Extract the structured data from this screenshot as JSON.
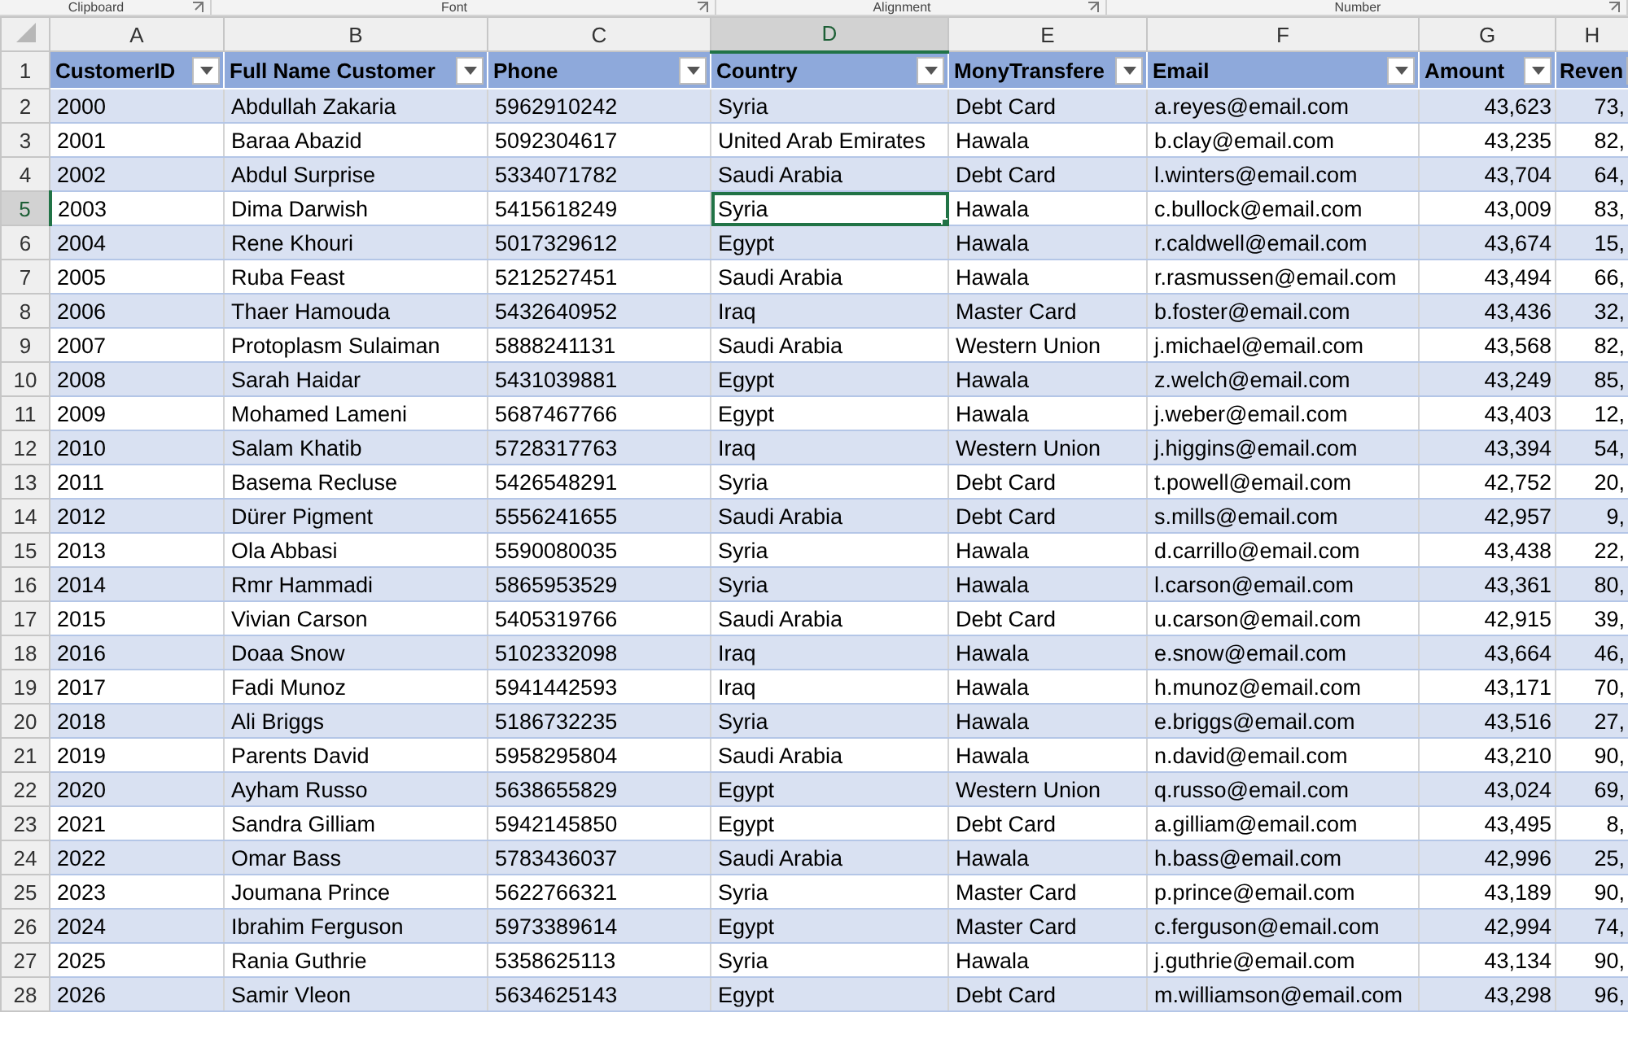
{
  "ribbon_groups": [
    "Clipboard",
    "Font",
    "Alignment",
    "Number"
  ],
  "columns": [
    {
      "letter": "A",
      "header": "CustomerID",
      "selected": false,
      "kind": "text"
    },
    {
      "letter": "B",
      "header": "Full Name Customer",
      "selected": false,
      "kind": "text"
    },
    {
      "letter": "C",
      "header": "Phone",
      "selected": false,
      "kind": "text"
    },
    {
      "letter": "D",
      "header": "Country",
      "selected": true,
      "kind": "text"
    },
    {
      "letter": "E",
      "header": "MonyTransfere",
      "selected": false,
      "kind": "text"
    },
    {
      "letter": "F",
      "header": "Email",
      "selected": false,
      "kind": "text"
    },
    {
      "letter": "G",
      "header": "Amount",
      "selected": false,
      "kind": "number"
    },
    {
      "letter": "H",
      "header": "Reven",
      "selected": false,
      "kind": "number"
    }
  ],
  "header_row_number": "1",
  "rows": [
    {
      "number": "2",
      "selected": false,
      "cells": [
        "2000",
        "Abdullah Zakaria",
        "5962910242",
        "Syria",
        "Debt Card",
        "a.reyes@email.com",
        "43,623",
        "73,"
      ]
    },
    {
      "number": "3",
      "selected": false,
      "cells": [
        "2001",
        "Baraa Abazid",
        "5092304617",
        "United Arab Emirates",
        "Hawala",
        "b.clay@email.com",
        "43,235",
        "82,"
      ]
    },
    {
      "number": "4",
      "selected": false,
      "cells": [
        "2002",
        "Abdul Surprise",
        "5334071782",
        "Saudi Arabia",
        "Debt Card",
        "l.winters@email.com",
        "43,704",
        "64,"
      ]
    },
    {
      "number": "5",
      "selected": true,
      "cells": [
        "2003",
        "Dima Darwish",
        "5415618249",
        "Syria",
        "Hawala",
        "c.bullock@email.com",
        "43,009",
        "83,"
      ]
    },
    {
      "number": "6",
      "selected": false,
      "cells": [
        "2004",
        "Rene Khouri",
        "5017329612",
        "Egypt",
        "Hawala",
        "r.caldwell@email.com",
        "43,674",
        "15,"
      ]
    },
    {
      "number": "7",
      "selected": false,
      "cells": [
        "2005",
        "Ruba Feast",
        "5212527451",
        "Saudi Arabia",
        "Hawala",
        "r.rasmussen@email.com",
        "43,494",
        "66,"
      ]
    },
    {
      "number": "8",
      "selected": false,
      "cells": [
        "2006",
        "Thaer Hamouda",
        "5432640952",
        "Iraq",
        "Master Card",
        "b.foster@email.com",
        "43,436",
        "32,"
      ]
    },
    {
      "number": "9",
      "selected": false,
      "cells": [
        "2007",
        "Protoplasm Sulaiman",
        "5888241131",
        "Saudi Arabia",
        "Western Union",
        "j.michael@email.com",
        "43,568",
        "82,"
      ]
    },
    {
      "number": "10",
      "selected": false,
      "cells": [
        "2008",
        "Sarah Haidar",
        "5431039881",
        "Egypt",
        "Hawala",
        "z.welch@email.com",
        "43,249",
        "85,"
      ]
    },
    {
      "number": "11",
      "selected": false,
      "cells": [
        "2009",
        "Mohamed Lameni",
        "5687467766",
        "Egypt",
        "Hawala",
        "j.weber@email.com",
        "43,403",
        "12,"
      ]
    },
    {
      "number": "12",
      "selected": false,
      "cells": [
        "2010",
        "Salam Khatib",
        "5728317763",
        "Iraq",
        "Western Union",
        "j.higgins@email.com",
        "43,394",
        "54,"
      ]
    },
    {
      "number": "13",
      "selected": false,
      "cells": [
        "2011",
        "Basema Recluse",
        "5426548291",
        "Syria",
        "Debt Card",
        "t.powell@email.com",
        "42,752",
        "20,"
      ]
    },
    {
      "number": "14",
      "selected": false,
      "cells": [
        "2012",
        "Dürer Pigment",
        "5556241655",
        "Saudi Arabia",
        "Debt Card",
        "s.mills@email.com",
        "42,957",
        "9,"
      ]
    },
    {
      "number": "15",
      "selected": false,
      "cells": [
        "2013",
        "Ola Abbasi",
        "5590080035",
        "Syria",
        "Hawala",
        "d.carrillo@email.com",
        "43,438",
        "22,"
      ]
    },
    {
      "number": "16",
      "selected": false,
      "cells": [
        "2014",
        "Rmr Hammadi",
        "5865953529",
        "Syria",
        "Hawala",
        "l.carson@email.com",
        "43,361",
        "80,"
      ]
    },
    {
      "number": "17",
      "selected": false,
      "cells": [
        "2015",
        "Vivian Carson",
        "5405319766",
        "Saudi Arabia",
        "Debt Card",
        "u.carson@email.com",
        "42,915",
        "39,"
      ]
    },
    {
      "number": "18",
      "selected": false,
      "cells": [
        "2016",
        "Doaa Snow",
        "5102332098",
        "Iraq",
        "Hawala",
        "e.snow@email.com",
        "43,664",
        "46,"
      ]
    },
    {
      "number": "19",
      "selected": false,
      "cells": [
        "2017",
        "Fadi Munoz",
        "5941442593",
        "Iraq",
        "Hawala",
        "h.munoz@email.com",
        "43,171",
        "70,"
      ]
    },
    {
      "number": "20",
      "selected": false,
      "cells": [
        "2018",
        "Ali Briggs",
        "5186732235",
        "Syria",
        "Hawala",
        "e.briggs@email.com",
        "43,516",
        "27,"
      ]
    },
    {
      "number": "21",
      "selected": false,
      "cells": [
        "2019",
        "Parents David",
        "5958295804",
        "Saudi Arabia",
        "Hawala",
        "n.david@email.com",
        "43,210",
        "90,"
      ]
    },
    {
      "number": "22",
      "selected": false,
      "cells": [
        "2020",
        "Ayham Russo",
        "5638655829",
        "Egypt",
        "Western Union",
        "q.russo@email.com",
        "43,024",
        "69,"
      ]
    },
    {
      "number": "23",
      "selected": false,
      "cells": [
        "2021",
        "Sandra Gilliam",
        "5942145850",
        "Egypt",
        "Debt Card",
        "a.gilliam@email.com",
        "43,495",
        "8,"
      ]
    },
    {
      "number": "24",
      "selected": false,
      "cells": [
        "2022",
        "Omar Bass",
        "5783436037",
        "Saudi Arabia",
        "Hawala",
        "h.bass@email.com",
        "42,996",
        "25,"
      ]
    },
    {
      "number": "25",
      "selected": false,
      "cells": [
        "2023",
        "Joumana Prince",
        "5622766321",
        "Syria",
        "Master Card",
        "p.prince@email.com",
        "43,189",
        "90,"
      ]
    },
    {
      "number": "26",
      "selected": false,
      "cells": [
        "2024",
        "Ibrahim Ferguson",
        "5973389614",
        "Egypt",
        "Master Card",
        "c.ferguson@email.com",
        "42,994",
        "74,"
      ]
    },
    {
      "number": "27",
      "selected": false,
      "cells": [
        "2025",
        "Rania Guthrie",
        "5358625113",
        "Syria",
        "Hawala",
        "j.guthrie@email.com",
        "43,134",
        "90,"
      ]
    },
    {
      "number": "28",
      "selected": false,
      "cells": [
        "2026",
        "Samir Vleon",
        "5634625143",
        "Egypt",
        "Debt Card",
        "m.williamson@email.com",
        "43,298",
        "96,"
      ]
    }
  ]
}
